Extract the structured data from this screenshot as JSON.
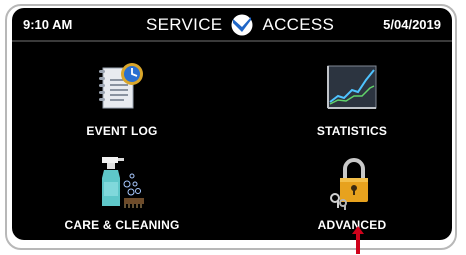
{
  "header": {
    "time": "9:10 AM",
    "title_left": "SERVICE",
    "title_right": "ACCESS",
    "date": "5/04/2019",
    "logo_icon": "blue-check-badge-icon"
  },
  "tiles": [
    {
      "label": "EVENT LOG",
      "icon": "clipboard-clock-icon"
    },
    {
      "label": "STATISTICS",
      "icon": "line-graph-icon"
    },
    {
      "label": "CARE & CLEANING",
      "icon": "spray-bottle-brush-icon"
    },
    {
      "label": "ADVANCED",
      "icon": "padlock-keys-icon"
    }
  ],
  "annotation": {
    "arrow_color": "#d0021b",
    "arrow_icon": "up-arrow-icon"
  },
  "colors": {
    "screen_bg": "#000000",
    "text": "#ffffff",
    "accent_blue": "#1f66c7"
  }
}
